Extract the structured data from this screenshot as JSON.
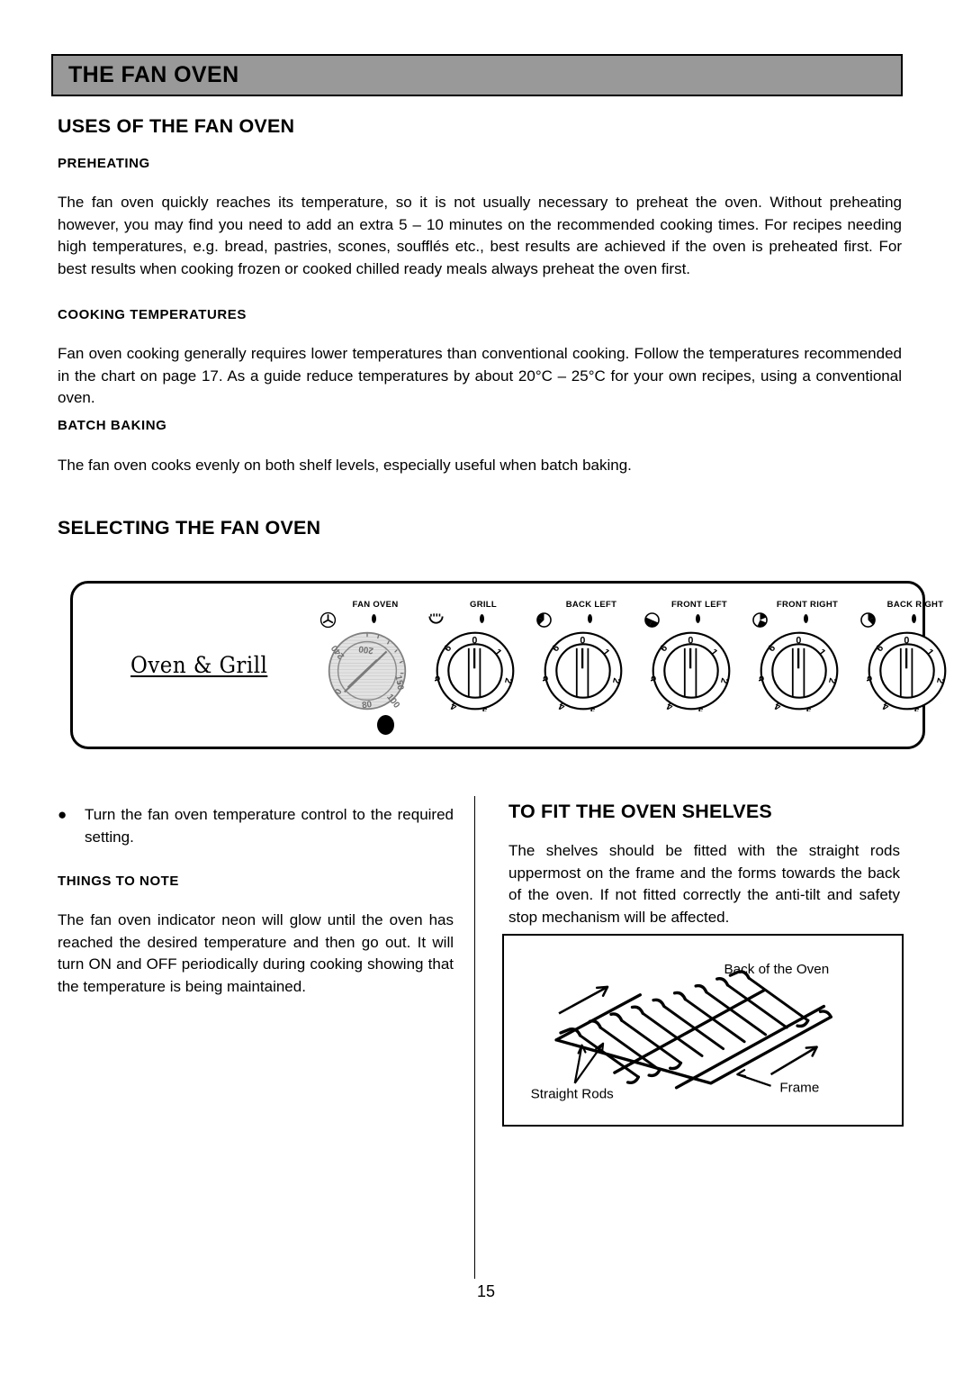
{
  "banner": {
    "title": "THE FAN OVEN"
  },
  "sections": {
    "uses": {
      "heading": "USES OF THE FAN OVEN",
      "preheating": {
        "subheading": "PREHEATING",
        "body": "The fan oven quickly reaches its temperature, so it is not usually necessary to preheat the oven.  Without preheating however, you may find you need to add an extra 5 – 10 minutes on the recommended cooking times. For recipes needing high temperatures, e.g. bread, pastries, scones, soufflés etc., best results are achieved if the oven is preheated first.  For best results when cooking frozen or cooked chilled ready meals always preheat the oven first."
      },
      "cooking_temperatures": {
        "subheading": "COOKING TEMPERATURES",
        "body": "Fan oven cooking generally requires lower temperatures than conventional cooking.  Follow the temperatures recommended in the chart on page 17. As a guide reduce temperatures by about 20°C – 25°C for your own recipes, using a conventional oven."
      },
      "batch_baking": {
        "subheading": "BATCH BAKING",
        "body": "The fan oven cooks evenly on both shelf levels, especially useful when batch baking."
      }
    },
    "selecting": {
      "heading": "SELECTING THE FAN OVEN",
      "bullet": "Turn the fan oven temperature control to the required setting.",
      "things_to_note": {
        "subheading": "THINGS TO NOTE",
        "body": "The fan oven indicator neon will glow until the oven has reached the desired temperature and then go out.  It will turn ON and OFF periodically during cooking showing that the temperature is being maintained."
      }
    },
    "shelves": {
      "heading": "TO FIT THE OVEN SHELVES",
      "body": "The shelves should be fitted with the straight rods uppermost on the frame and the forms towards the back of the oven.  If not fitted correctly the anti-tilt and safety stop mechanism will be affected.",
      "figure": {
        "label_back": "Back of the Oven",
        "label_rods": "Straight Rods",
        "label_frame": "Frame"
      }
    }
  },
  "control_panel": {
    "brand": "Oven & Grill",
    "neon_indicator": "fan-oven-neon",
    "knobs": [
      {
        "label": "FAN OVEN",
        "icon": "fan-icon",
        "type": "temperature",
        "scale": [
          "0",
          "80",
          "100",
          "150",
          "200",
          "240"
        ],
        "shaded": true
      },
      {
        "label": "GRILL",
        "icon": "grill-element-icon",
        "type": "numeric",
        "scale": [
          "0",
          "1",
          "2",
          "3",
          "4",
          "5",
          "6"
        ],
        "shaded": false
      },
      {
        "label": "BACK LEFT",
        "icon": "hotplate-back-left-icon",
        "type": "numeric",
        "scale": [
          "0",
          "1",
          "2",
          "3",
          "4",
          "5",
          "6"
        ],
        "shaded": false
      },
      {
        "label": "FRONT LEFT",
        "icon": "hotplate-front-left-icon",
        "type": "numeric",
        "scale": [
          "0",
          "1",
          "2",
          "3",
          "4",
          "5",
          "6"
        ],
        "shaded": false
      },
      {
        "label": "FRONT RIGHT",
        "icon": "hotplate-front-right-icon",
        "type": "numeric",
        "scale": [
          "0",
          "1",
          "2",
          "3",
          "4",
          "5",
          "6"
        ],
        "shaded": false
      },
      {
        "label": "BACK RIGHT",
        "icon": "hotplate-back-right-icon",
        "type": "numeric",
        "scale": [
          "0",
          "1",
          "2",
          "3",
          "4",
          "5",
          "6"
        ],
        "shaded": false
      }
    ]
  },
  "footer": {
    "page_number": "15"
  }
}
